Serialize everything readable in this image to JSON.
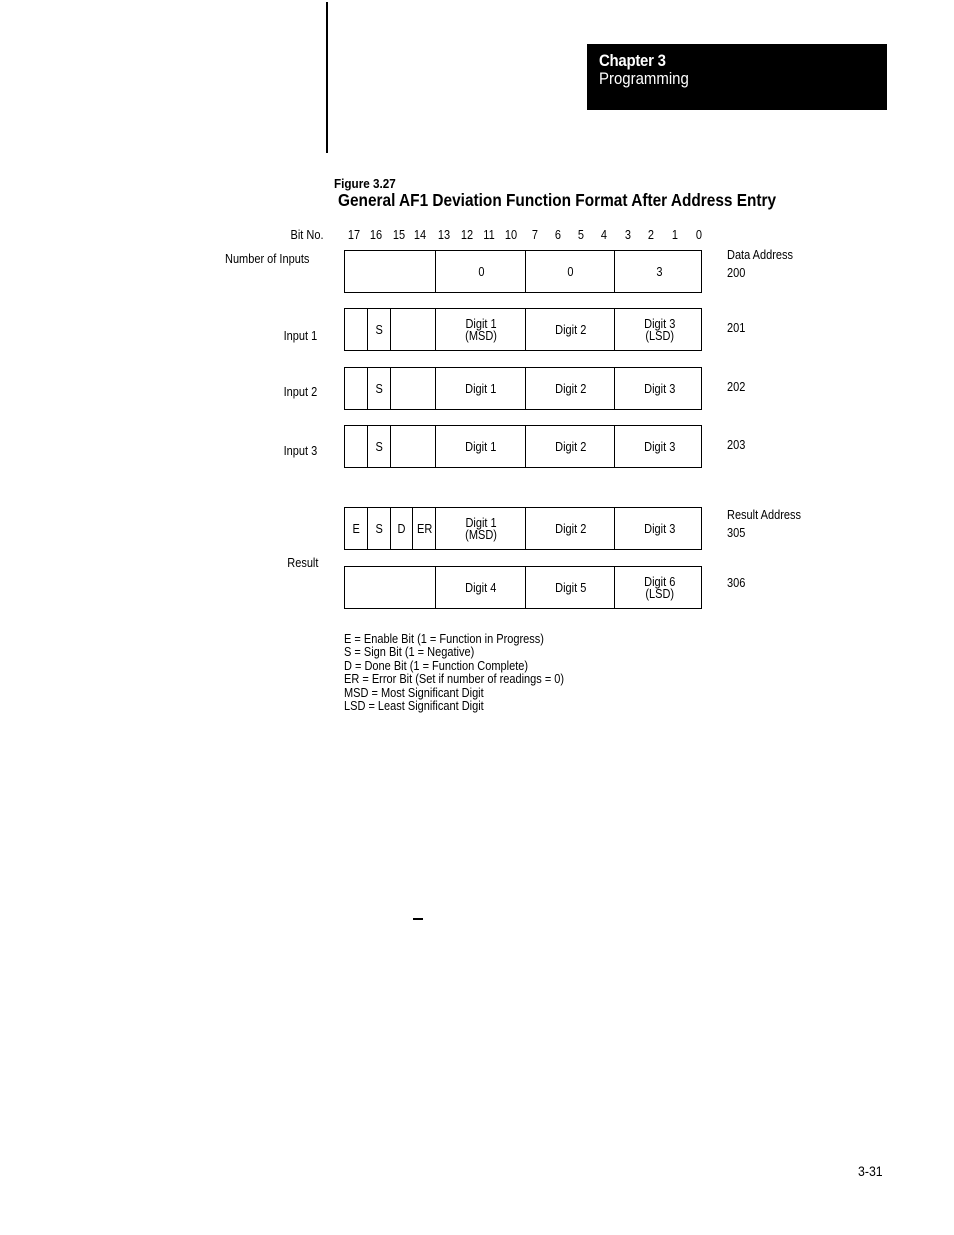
{
  "header": {
    "chapter": "Chapter 3",
    "section": "Programming"
  },
  "figure": {
    "number": "Figure 3.27",
    "title": "General AF1 Deviation Function Format After Address Entry"
  },
  "bits": {
    "label": "Bit No.",
    "numbers": [
      "17",
      "16",
      "15",
      "14",
      "13",
      "12",
      "11",
      "10",
      "7",
      "6",
      "5",
      "4",
      "3",
      "2",
      "1",
      "0"
    ]
  },
  "rows": {
    "number_of_inputs": {
      "label": "Number of Inputs",
      "address_caption": "Data Address",
      "address": "200",
      "cells": [
        "",
        "0",
        "0",
        "3"
      ]
    },
    "input1": {
      "label": "Input 1",
      "address": "201",
      "cells": [
        "",
        "S",
        "",
        "Digit 1\n(MSD)",
        "Digit 2",
        "Digit 3\n(LSD)"
      ]
    },
    "input2": {
      "label": "Input 2",
      "address": "202",
      "cells": [
        "",
        "S",
        "",
        "Digit 1",
        "Digit 2",
        "Digit 3"
      ]
    },
    "input3": {
      "label": "Input 3",
      "address": "203",
      "cells": [
        "",
        "S",
        "",
        "Digit 1",
        "Digit 2",
        "Digit 3"
      ]
    },
    "result1": {
      "address_caption": "Result Address",
      "address": "305",
      "cells": [
        "E",
        "S",
        "D",
        "ER",
        "Digit 1\n(MSD)",
        "Digit 2",
        "Digit 3"
      ]
    },
    "result2": {
      "label": "Result",
      "address": "306",
      "cells": [
        "",
        "Digit 4",
        "Digit 5",
        "Digit 6\n(LSD)"
      ]
    }
  },
  "legend": [
    "E = Enable Bit (1 = Function in Progress)",
    "S = Sign Bit (1 = Negative)",
    "D = Done Bit (1 = Function Complete)",
    "ER = Error Bit (Set if number of readings = 0)",
    "MSD = Most Significant Digit",
    "LSD = Least Significant Digit"
  ],
  "footer": {
    "dash": "—",
    "page_number": "3-31"
  }
}
